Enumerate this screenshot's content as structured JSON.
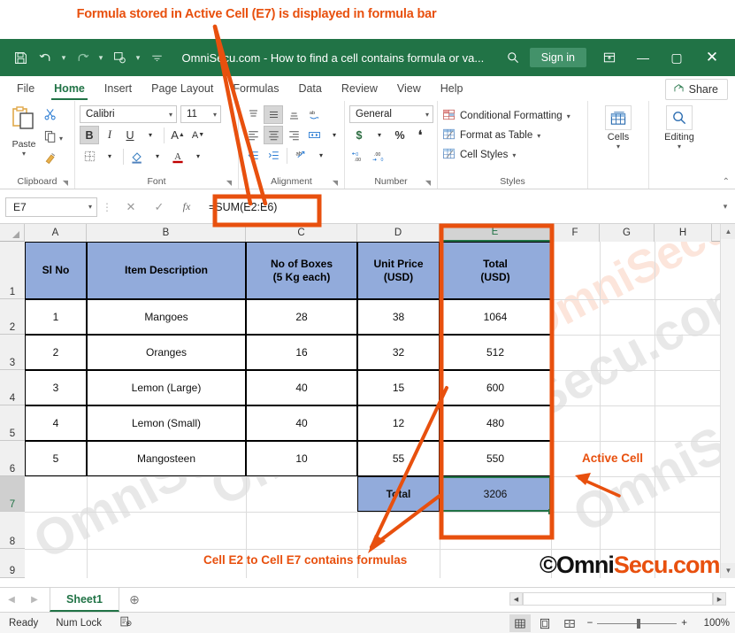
{
  "annotations": {
    "top_note": "Formula stored in Active Cell (E7) is displayed in formula bar",
    "bottom_note": "Cell E2 to Cell E7 contains formulas",
    "active_cell_note": "Active Cell",
    "logo_black": "©Omni",
    "logo_orange": "Secu.com",
    "accent_color": "#E8500E"
  },
  "titlebar": {
    "title": "OmniSecu.com - How to find a cell contains formula or va...",
    "signin": "Sign in",
    "save_icon": "save-icon",
    "undo_icon": "undo-icon",
    "redo_icon": "redo-icon",
    "touch_icon": "touch-mode-icon",
    "more_icon": "more-icon",
    "search_icon": "search-icon",
    "ribbon_display_icon": "ribbon-display-options-icon",
    "minimize": "—",
    "maximize": "▢",
    "close": "✕"
  },
  "tabs": {
    "items": [
      {
        "label": "File",
        "active": false
      },
      {
        "label": "Home",
        "active": true
      },
      {
        "label": "Insert",
        "active": false
      },
      {
        "label": "Page Layout",
        "active": false
      },
      {
        "label": "Formulas",
        "active": false
      },
      {
        "label": "Data",
        "active": false
      },
      {
        "label": "Review",
        "active": false
      },
      {
        "label": "View",
        "active": false
      },
      {
        "label": "Help",
        "active": false
      }
    ],
    "share": "Share"
  },
  "ribbon": {
    "clipboard": {
      "label": "Clipboard",
      "paste": "Paste",
      "cut_icon": "scissors-icon",
      "copy_icon": "copy-icon",
      "format_painter_icon": "format-painter-icon"
    },
    "font": {
      "label": "Font",
      "font_name": "Calibri",
      "font_size": "11",
      "bold": "B",
      "italic": "I",
      "underline": "U",
      "grow_font": "A",
      "shrink_font": "A",
      "borders_icon": "borders-icon",
      "fill_color_icon": "fill-color-icon",
      "font_color_icon": "font-color-icon"
    },
    "alignment": {
      "label": "Alignment",
      "top_align_icon": "align-top-icon",
      "middle_align_icon": "align-middle-icon",
      "bottom_align_icon": "align-bottom-icon",
      "orientation_icon": "orientation-icon",
      "align_left_icon": "align-left-icon",
      "align_center_icon": "align-center-icon",
      "align_right_icon": "align-right-icon",
      "merge_icon": "merge-and-center-icon",
      "decrease_indent_icon": "decrease-indent-icon",
      "increase_indent_icon": "increase-indent-icon",
      "wrap_text_icon": "wrap-text-icon"
    },
    "number": {
      "label": "Number",
      "format": "General",
      "currency": "$",
      "percent": "%",
      "comma": "❞",
      "increase_decimal": ".00",
      "decrease_decimal": ".00"
    },
    "styles": {
      "label": "Styles",
      "items": [
        "Conditional Formatting",
        "Format as Table",
        "Cell Styles"
      ]
    },
    "cells": {
      "label": "Cells",
      "icon": "cells-icon"
    },
    "editing": {
      "label": "Editing",
      "icon": "find-select-icon"
    }
  },
  "formula_bar": {
    "name_box": "E7",
    "cancel_icon": "cancel-icon",
    "enter_icon": "confirm-icon",
    "fx_icon": "insert-function-icon",
    "formula": "=SUM(E2:E6)",
    "expand_icon": "expand-formula-bar-icon"
  },
  "grid": {
    "columns": [
      "A",
      "B",
      "C",
      "D",
      "E",
      "F",
      "G",
      "H"
    ],
    "selected_column": "E",
    "rows": [
      "1",
      "2",
      "3",
      "4",
      "5",
      "6",
      "7",
      "8",
      "9"
    ],
    "selected_row": "7",
    "active_cell": "E7",
    "headers": [
      "Sl No",
      "Item Description",
      "No of Boxes\n(5 Kg each)",
      "Unit Price\n(USD)",
      "Total\n(USD)"
    ],
    "header_lines": {
      "a": [
        "Sl No"
      ],
      "b": [
        "Item Description"
      ],
      "c": [
        "No of Boxes",
        "(5 Kg each)"
      ],
      "d": [
        "Unit Price",
        "(USD)"
      ],
      "e": [
        "Total",
        "(USD)"
      ]
    },
    "data_rows": [
      {
        "sl": "1",
        "item": "Mangoes",
        "boxes": "28",
        "price": "38",
        "total": "1064"
      },
      {
        "sl": "2",
        "item": "Oranges",
        "boxes": "16",
        "price": "32",
        "total": "512"
      },
      {
        "sl": "3",
        "item": "Lemon (Large)",
        "boxes": "40",
        "price": "15",
        "total": "600"
      },
      {
        "sl": "4",
        "item": "Lemon (Small)",
        "boxes": "40",
        "price": "12",
        "total": "480"
      },
      {
        "sl": "5",
        "item": "Mangosteen",
        "boxes": "10",
        "price": "55",
        "total": "550"
      }
    ],
    "total_row": {
      "label": "Total",
      "value": "3206"
    },
    "watermark": "OmniSecu.com"
  },
  "sheetbar": {
    "prev_icon": "previous-sheet-icon",
    "next_icon": "next-sheet-icon",
    "sheet_name": "Sheet1",
    "add_sheet_icon": "add-sheet-icon"
  },
  "statusbar": {
    "mode": "Ready",
    "num_lock": "Num Lock",
    "accessibility_icon": "accessibility-icon",
    "normal_view_icon": "normal-view-icon",
    "page_layout_icon": "page-layout-view-icon",
    "page_break_icon": "page-break-view-icon",
    "zoom_out": "−",
    "zoom_in": "+",
    "zoom_level": "100%"
  }
}
